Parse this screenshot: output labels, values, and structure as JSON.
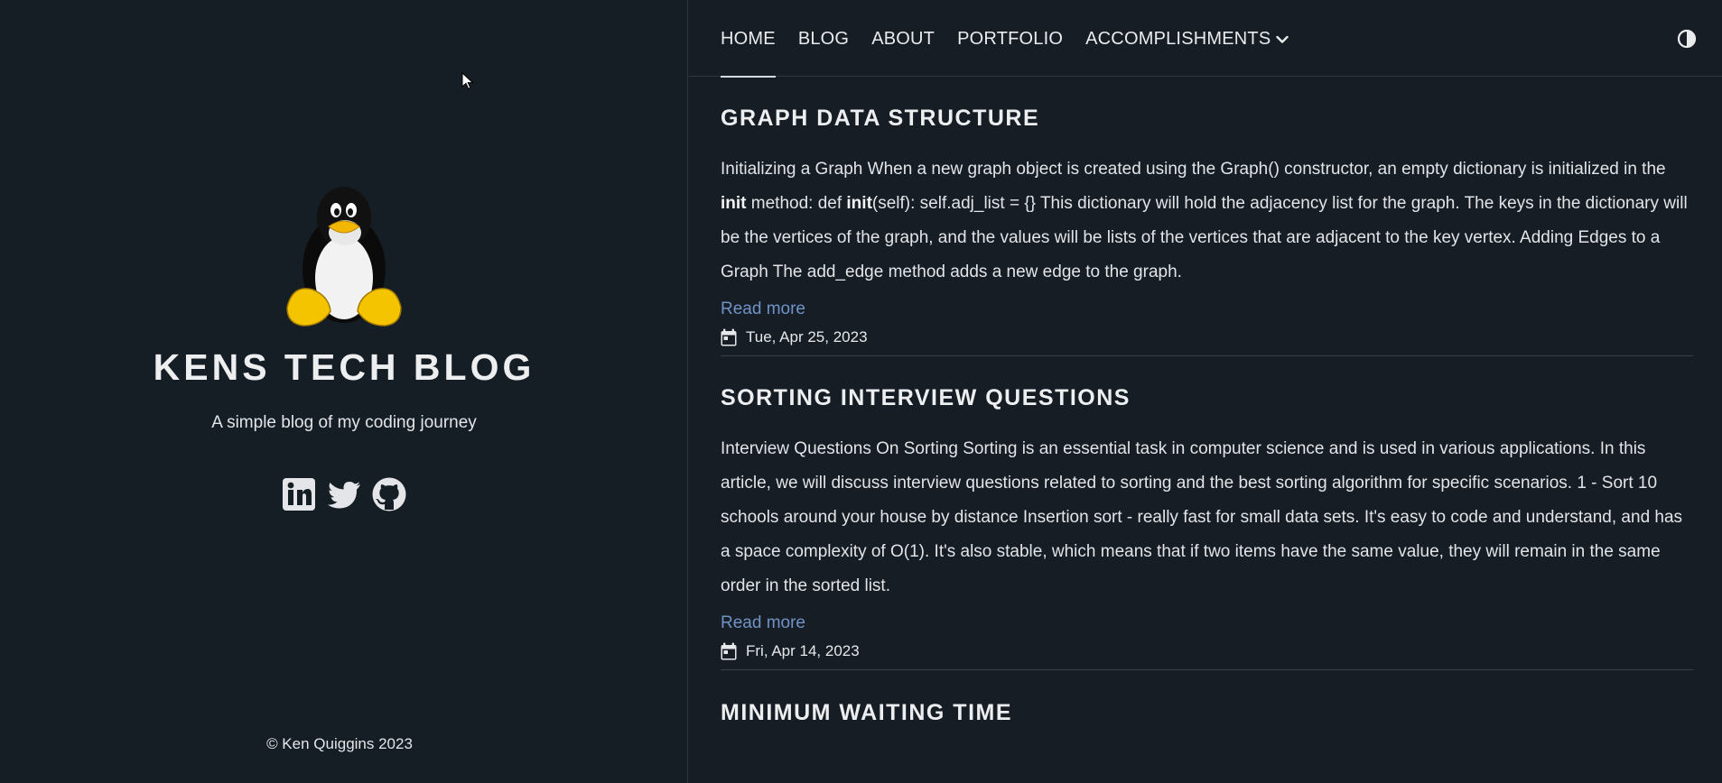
{
  "site": {
    "title": "KENS TECH BLOG",
    "subtitle": "A simple blog of my coding journey",
    "copyright": "© Ken Quiggins 2023",
    "socials": [
      {
        "icon": "linkedin-icon"
      },
      {
        "icon": "twitter-icon"
      },
      {
        "icon": "github-icon"
      }
    ]
  },
  "nav": {
    "items": [
      {
        "label": "HOME",
        "active": true
      },
      {
        "label": "BLOG"
      },
      {
        "label": "ABOUT"
      },
      {
        "label": "PORTFOLIO"
      },
      {
        "label": "ACCOMPLISHMENTS",
        "dropdown": true
      }
    ],
    "theme_toggle_icon": "contrast-icon"
  },
  "posts": [
    {
      "title": "GRAPH DATA STRUCTURE",
      "summary_parts": [
        "Initializing a Graph When a new graph object is created using the Graph() constructor, an empty dictionary is initialized in the ",
        "init",
        " method: def ",
        "init",
        "(self): self.adj_list = {} This dictionary will hold the adjacency list for the graph. The keys in the dictionary will be the vertices of the graph, and the values will be lists of the vertices that are adjacent to the key vertex. Adding Edges to a Graph The add_edge method adds a new edge to the graph."
      ],
      "read_more": "Read more",
      "date": "Tue, Apr 25, 2023"
    },
    {
      "title": "SORTING INTERVIEW QUESTIONS",
      "summary": "Interview Questions On Sorting Sorting is an essential task in computer science and is used in various applications. In this article, we will discuss interview questions related to sorting and the best sorting algorithm for specific scenarios. 1 - Sort 10 schools around your house by distance Insertion sort - really fast for small data sets. It's easy to code and understand, and has a space complexity of O(1). It's also stable, which means that if two items have the same value, they will remain in the same order in the sorted list.",
      "read_more": "Read more",
      "date": "Fri, Apr 14, 2023"
    },
    {
      "title": "MINIMUM WAITING TIME"
    }
  ],
  "colors": {
    "background": "#161d24",
    "link": "#6f93c6",
    "text": "#e6e8ea"
  }
}
